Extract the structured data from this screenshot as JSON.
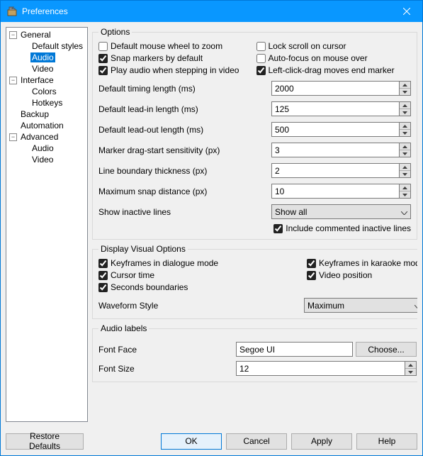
{
  "title": "Preferences",
  "tree": {
    "general": "General",
    "default_styles": "Default styles",
    "audio": "Audio",
    "video": "Video",
    "interface": "Interface",
    "colors": "Colors",
    "hotkeys": "Hotkeys",
    "backup": "Backup",
    "automation": "Automation",
    "advanced": "Advanced",
    "adv_audio": "Audio",
    "adv_video": "Video"
  },
  "groups": {
    "options": "Options",
    "display": "Display Visual Options",
    "audiolabels": "Audio labels"
  },
  "opts": {
    "default_wheel_zoom": {
      "label": "Default mouse wheel to zoom",
      "checked": false
    },
    "lock_scroll": {
      "label": "Lock scroll on cursor",
      "checked": false
    },
    "snap_markers": {
      "label": "Snap markers by default",
      "checked": true
    },
    "auto_focus": {
      "label": "Auto-focus on mouse over",
      "checked": false
    },
    "play_audio": {
      "label": "Play audio when stepping in video",
      "checked": true
    },
    "left_click_drag": {
      "label": "Left-click-drag moves end marker",
      "checked": true
    },
    "include_commented": {
      "label": "Include commented inactive lines",
      "checked": true
    }
  },
  "numlabels": {
    "timing": "Default timing length (ms)",
    "leadin": "Default lead-in length (ms)",
    "leadout": "Default lead-out length (ms)",
    "dragstart": "Marker drag-start sensitivity (px)",
    "linebound": "Line boundary thickness (px)",
    "snapdist": "Maximum snap distance (px)",
    "inactive": "Show inactive lines"
  },
  "numvals": {
    "timing": "2000",
    "leadin": "125",
    "leadout": "500",
    "dragstart": "3",
    "linebound": "2",
    "snapdist": "10"
  },
  "inactive_value": "Show all",
  "disp": {
    "kf_dialogue": {
      "label": "Keyframes in dialogue mode",
      "checked": true
    },
    "kf_karaoke": {
      "label": "Keyframes in karaoke mode",
      "checked": true
    },
    "cursor_time": {
      "label": "Cursor time",
      "checked": true
    },
    "video_pos": {
      "label": "Video position",
      "checked": true
    },
    "seconds": {
      "label": "Seconds boundaries",
      "checked": true
    }
  },
  "waveform": {
    "label": "Waveform Style",
    "value": "Maximum"
  },
  "font": {
    "face_label": "Font Face",
    "face_value": "Segoe UI",
    "choose": "Choose...",
    "size_label": "Font Size",
    "size_value": "12"
  },
  "footer": {
    "restore": "Restore Defaults",
    "ok": "OK",
    "cancel": "Cancel",
    "apply": "Apply",
    "help": "Help"
  }
}
